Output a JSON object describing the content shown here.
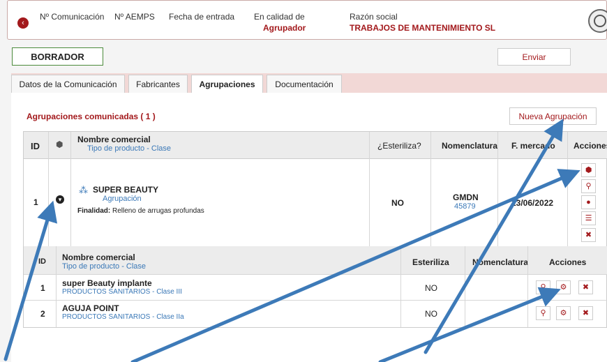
{
  "header": {
    "col_comunicacion": "Nº Comunicación",
    "col_aemps": "Nº AEMPS",
    "col_fecha": "Fecha de entrada",
    "col_calidad": "En calidad de",
    "val_calidad": "Agrupador",
    "col_razon": "Razón social",
    "val_razon": "TRABAJOS DE MANTENIMIENTO SL"
  },
  "toolbar": {
    "status_label": "BORRADOR",
    "send_label": "Enviar"
  },
  "tabs": [
    {
      "label": "Datos de la Comunicación"
    },
    {
      "label": "Fabricantes"
    },
    {
      "label": "Agrupaciones"
    },
    {
      "label": "Documentación"
    }
  ],
  "section": {
    "title": "Agrupaciones comunicadas ( 1 )",
    "new_button": "Nueva Agrupación"
  },
  "table": {
    "h_id": "ID",
    "h_nombre": "Nombre comercial",
    "h_tipo": "Tipo de producto - Clase",
    "h_esteriliza": "¿Esteriliza?",
    "h_nomenclatura": "Nomenclatura",
    "h_fmercado": "F. mercado",
    "h_acciones": "Acciones",
    "row": {
      "id": "1",
      "name": "SUPER BEAUTY",
      "type": "Agrupación",
      "finalidad_label": "Finalidad:",
      "finalidad_value": "Relleno de arrugas profundas",
      "esteriliza": "NO",
      "nomen_code": "GMDN",
      "nomen_num": "45879",
      "fecha": "13/06/2022"
    }
  },
  "subtable": {
    "h_id": "ID",
    "h_nombre": "Nombre comercial",
    "h_tipo": "Tipo de producto - Clase",
    "h_esteriliza": "Esteriliza",
    "h_nomenclatura": "Nomenclatura",
    "h_acciones": "Acciones",
    "rows": [
      {
        "id": "1",
        "name": "super Beauty implante",
        "type": "PRODUCTOS SANITARIOS - Clase III",
        "esteriliza": "NO"
      },
      {
        "id": "2",
        "name": "AGUJA POINT",
        "type": "PRODUCTOS SANITARIOS - Clase IIa",
        "esteriliza": "NO"
      }
    ]
  },
  "colors": {
    "accent": "#a3191c",
    "link": "#3a78b7",
    "arrow": "#3d7ab8"
  }
}
